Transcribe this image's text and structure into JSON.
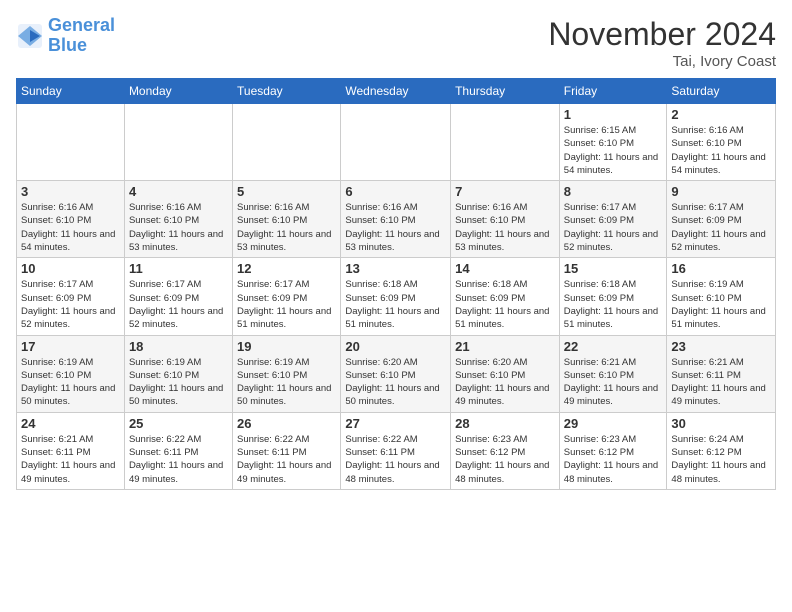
{
  "logo": {
    "line1": "General",
    "line2": "Blue"
  },
  "title": "November 2024",
  "location": "Tai, Ivory Coast",
  "days_header": [
    "Sunday",
    "Monday",
    "Tuesday",
    "Wednesday",
    "Thursday",
    "Friday",
    "Saturday"
  ],
  "weeks": [
    {
      "days": [
        {
          "num": "",
          "info": ""
        },
        {
          "num": "",
          "info": ""
        },
        {
          "num": "",
          "info": ""
        },
        {
          "num": "",
          "info": ""
        },
        {
          "num": "",
          "info": ""
        },
        {
          "num": "1",
          "info": "Sunrise: 6:15 AM\nSunset: 6:10 PM\nDaylight: 11 hours and 54 minutes."
        },
        {
          "num": "2",
          "info": "Sunrise: 6:16 AM\nSunset: 6:10 PM\nDaylight: 11 hours and 54 minutes."
        }
      ]
    },
    {
      "days": [
        {
          "num": "3",
          "info": "Sunrise: 6:16 AM\nSunset: 6:10 PM\nDaylight: 11 hours and 54 minutes."
        },
        {
          "num": "4",
          "info": "Sunrise: 6:16 AM\nSunset: 6:10 PM\nDaylight: 11 hours and 53 minutes."
        },
        {
          "num": "5",
          "info": "Sunrise: 6:16 AM\nSunset: 6:10 PM\nDaylight: 11 hours and 53 minutes."
        },
        {
          "num": "6",
          "info": "Sunrise: 6:16 AM\nSunset: 6:10 PM\nDaylight: 11 hours and 53 minutes."
        },
        {
          "num": "7",
          "info": "Sunrise: 6:16 AM\nSunset: 6:10 PM\nDaylight: 11 hours and 53 minutes."
        },
        {
          "num": "8",
          "info": "Sunrise: 6:17 AM\nSunset: 6:09 PM\nDaylight: 11 hours and 52 minutes."
        },
        {
          "num": "9",
          "info": "Sunrise: 6:17 AM\nSunset: 6:09 PM\nDaylight: 11 hours and 52 minutes."
        }
      ]
    },
    {
      "days": [
        {
          "num": "10",
          "info": "Sunrise: 6:17 AM\nSunset: 6:09 PM\nDaylight: 11 hours and 52 minutes."
        },
        {
          "num": "11",
          "info": "Sunrise: 6:17 AM\nSunset: 6:09 PM\nDaylight: 11 hours and 52 minutes."
        },
        {
          "num": "12",
          "info": "Sunrise: 6:17 AM\nSunset: 6:09 PM\nDaylight: 11 hours and 51 minutes."
        },
        {
          "num": "13",
          "info": "Sunrise: 6:18 AM\nSunset: 6:09 PM\nDaylight: 11 hours and 51 minutes."
        },
        {
          "num": "14",
          "info": "Sunrise: 6:18 AM\nSunset: 6:09 PM\nDaylight: 11 hours and 51 minutes."
        },
        {
          "num": "15",
          "info": "Sunrise: 6:18 AM\nSunset: 6:09 PM\nDaylight: 11 hours and 51 minutes."
        },
        {
          "num": "16",
          "info": "Sunrise: 6:19 AM\nSunset: 6:10 PM\nDaylight: 11 hours and 51 minutes."
        }
      ]
    },
    {
      "days": [
        {
          "num": "17",
          "info": "Sunrise: 6:19 AM\nSunset: 6:10 PM\nDaylight: 11 hours and 50 minutes."
        },
        {
          "num": "18",
          "info": "Sunrise: 6:19 AM\nSunset: 6:10 PM\nDaylight: 11 hours and 50 minutes."
        },
        {
          "num": "19",
          "info": "Sunrise: 6:19 AM\nSunset: 6:10 PM\nDaylight: 11 hours and 50 minutes."
        },
        {
          "num": "20",
          "info": "Sunrise: 6:20 AM\nSunset: 6:10 PM\nDaylight: 11 hours and 50 minutes."
        },
        {
          "num": "21",
          "info": "Sunrise: 6:20 AM\nSunset: 6:10 PM\nDaylight: 11 hours and 49 minutes."
        },
        {
          "num": "22",
          "info": "Sunrise: 6:21 AM\nSunset: 6:10 PM\nDaylight: 11 hours and 49 minutes."
        },
        {
          "num": "23",
          "info": "Sunrise: 6:21 AM\nSunset: 6:11 PM\nDaylight: 11 hours and 49 minutes."
        }
      ]
    },
    {
      "days": [
        {
          "num": "24",
          "info": "Sunrise: 6:21 AM\nSunset: 6:11 PM\nDaylight: 11 hours and 49 minutes."
        },
        {
          "num": "25",
          "info": "Sunrise: 6:22 AM\nSunset: 6:11 PM\nDaylight: 11 hours and 49 minutes."
        },
        {
          "num": "26",
          "info": "Sunrise: 6:22 AM\nSunset: 6:11 PM\nDaylight: 11 hours and 49 minutes."
        },
        {
          "num": "27",
          "info": "Sunrise: 6:22 AM\nSunset: 6:11 PM\nDaylight: 11 hours and 48 minutes."
        },
        {
          "num": "28",
          "info": "Sunrise: 6:23 AM\nSunset: 6:12 PM\nDaylight: 11 hours and 48 minutes."
        },
        {
          "num": "29",
          "info": "Sunrise: 6:23 AM\nSunset: 6:12 PM\nDaylight: 11 hours and 48 minutes."
        },
        {
          "num": "30",
          "info": "Sunrise: 6:24 AM\nSunset: 6:12 PM\nDaylight: 11 hours and 48 minutes."
        }
      ]
    }
  ]
}
